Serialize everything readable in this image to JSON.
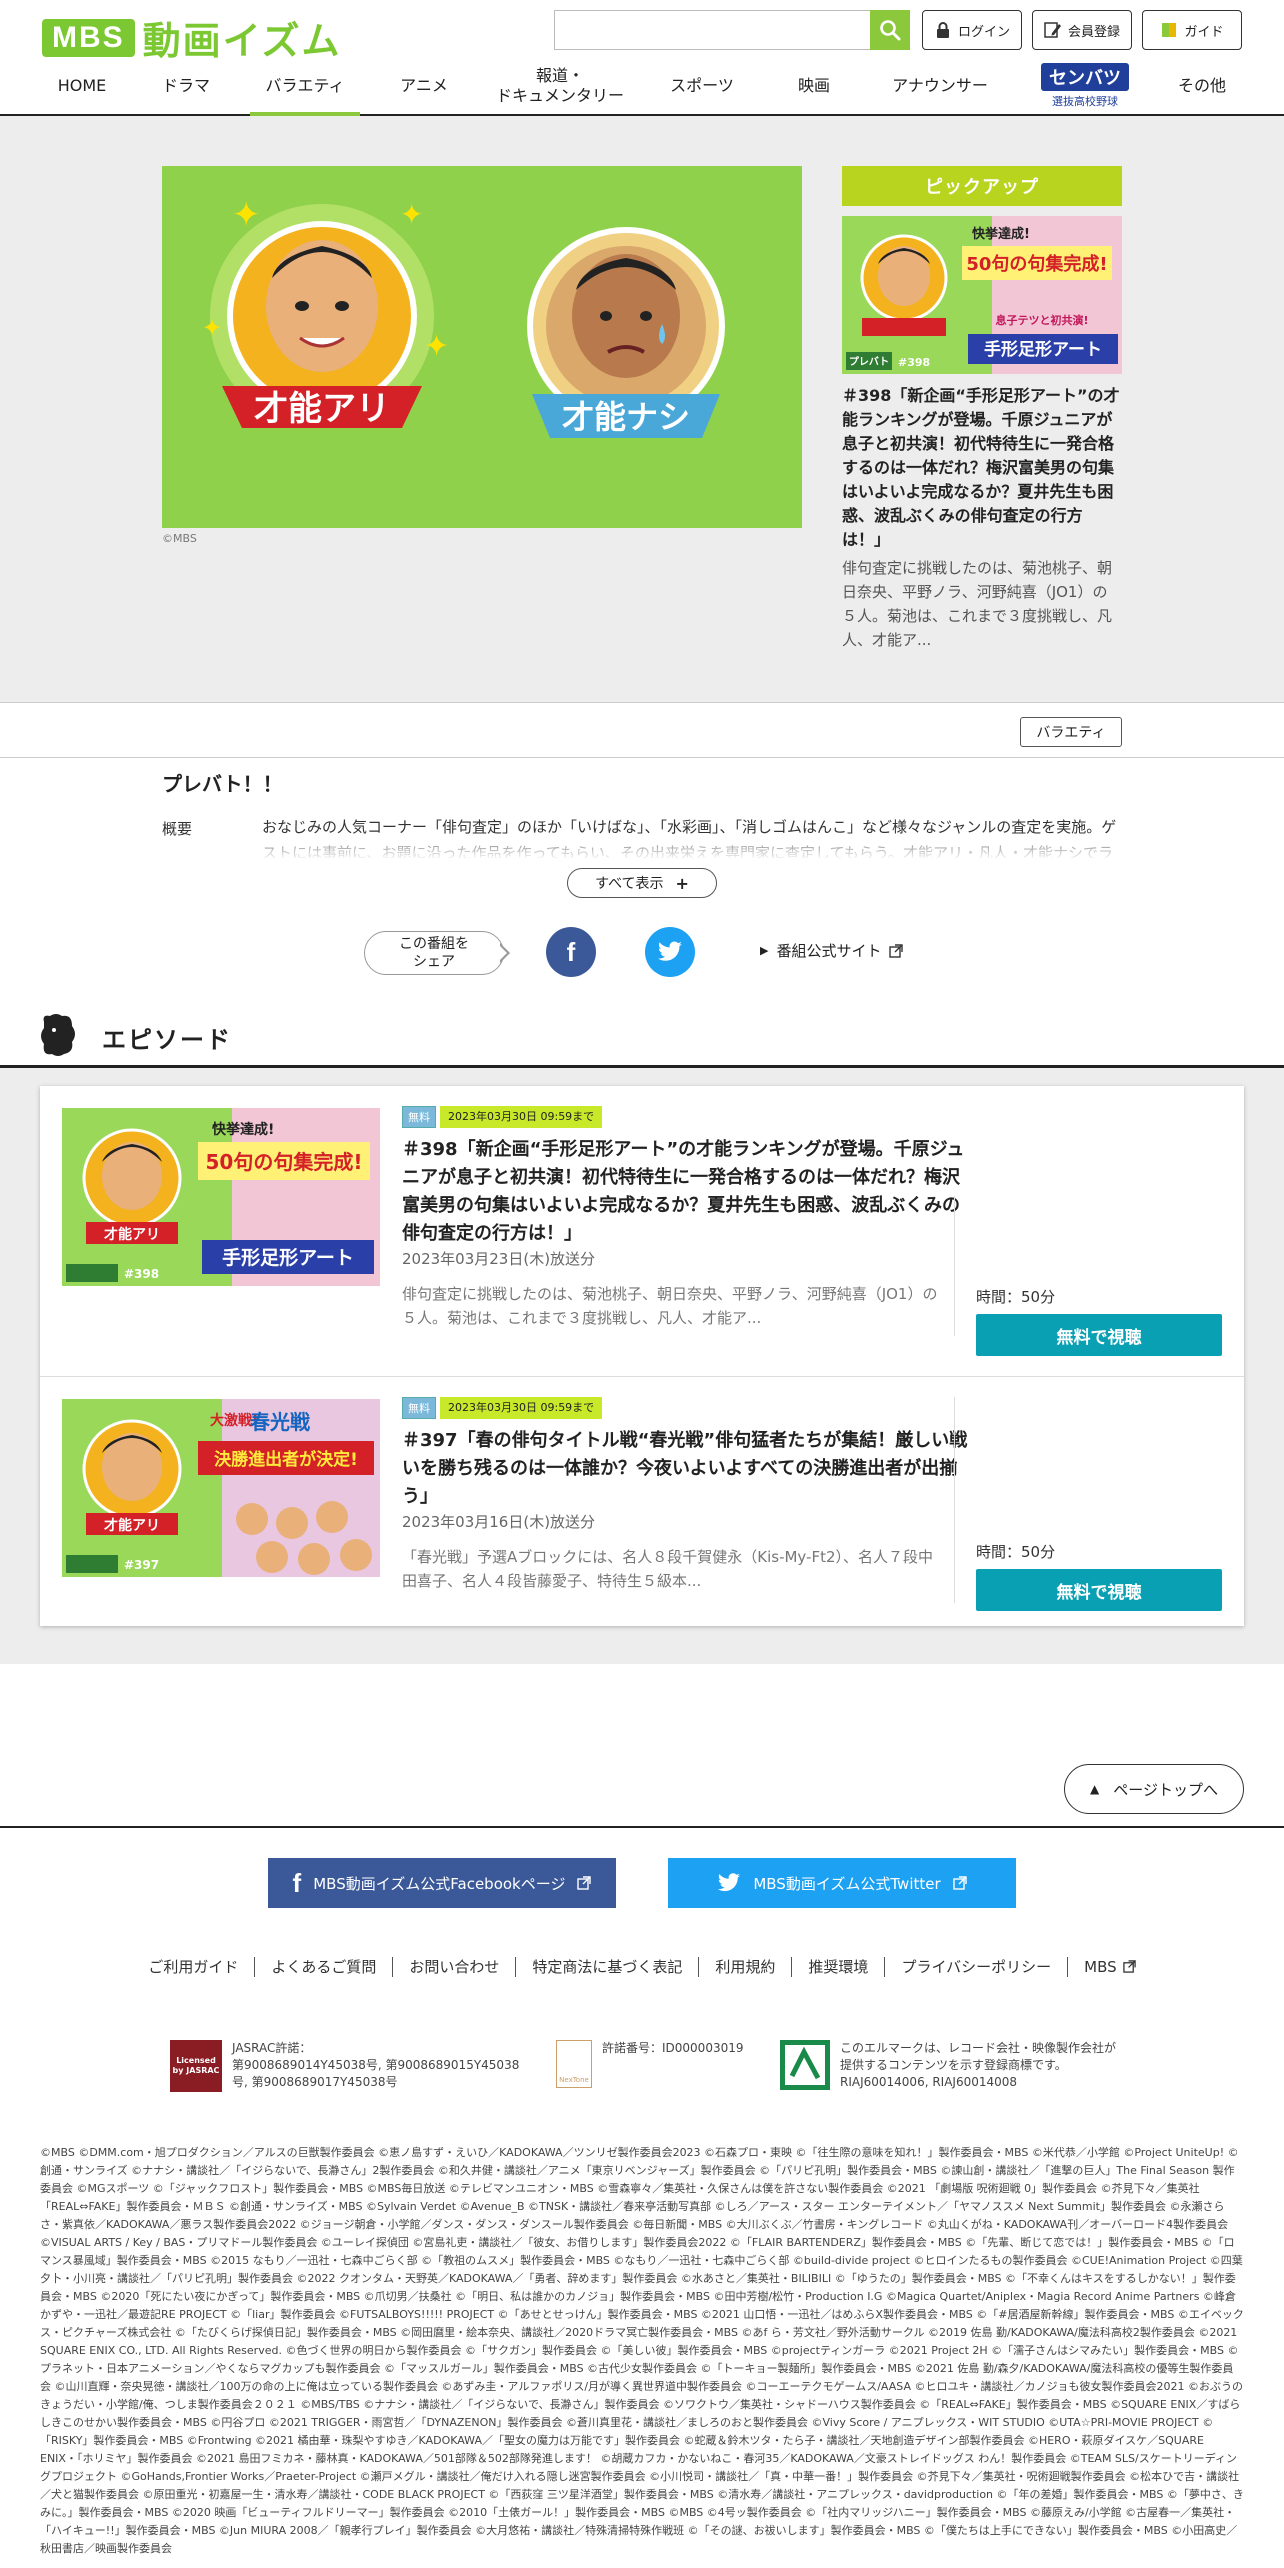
{
  "header": {
    "logo_mark": "MBS",
    "logo_text": "動画イズム",
    "search_placeholder": "",
    "login_label": "ログイン",
    "register_label": "会員登録",
    "guide_label": "ガイド"
  },
  "nav": {
    "items": [
      "HOME",
      "ドラマ",
      "バラエティ",
      "アニメ",
      "報道・",
      "ドキュメンタリー",
      "スポーツ",
      "映画",
      "アナウンサー",
      "その他"
    ],
    "senbatsu_logo": "センバツ",
    "senbatsu_sub": "選抜高校野球",
    "active": "バラエティ"
  },
  "hero": {
    "banner_left": "才能アリ",
    "banner_right": "才能ナシ",
    "copyright": "©MBS",
    "pickup_heading": "ピックアップ",
    "pickup_thumb_text1": "快挙達成!",
    "pickup_thumb_text2": "50句の句集完成!",
    "pickup_thumb_text3": "息子テツと初共演!",
    "pickup_thumb_text4": "手形足形アート",
    "pickup_thumb_brand": "プレバト",
    "pickup_thumb_num": "#398",
    "pickup_title": "＃398「新企画“手形足形アート”の才能ランキングが登場。千原ジュニアが息子と初共演！初代特待生に一発合格するのは一体だれ？梅沢富美男の句集はいよいよ完成なるか？夏井先生も困惑、波乱ぶくみの俳句査定の行方は！」",
    "pickup_desc": "俳句査定に挑戦したのは、菊池桃子、朝日奈央、平野ノラ、河野純喜（JO1）の５人。菊池は、これまで３度挑戦し、凡人、才能ア..."
  },
  "category": {
    "tag": "バラエティ"
  },
  "program": {
    "title": "プレバト！！",
    "overview_label": "概要",
    "overview_text": "おなじみの人気コーナー「俳句査定」のほか「いけばな」、「水彩画」、「消しゴムはんこ」など様々なジャンルの査定を実施。ゲストには事前に、お題に沿った作品を作ってもらい、その出来栄えを専門家に査定してもらう。才能アリ・凡人・才能ナシでランク付け。",
    "show_all": "すべて表示",
    "share_label": "この番組を\nシェア",
    "share_label_line1": "この番組を",
    "share_label_line2": "シェア",
    "official_site": "番組公式サイト"
  },
  "episodes_heading": "エピソード",
  "episodes": [
    {
      "badge_free": "無料",
      "badge_date": "2023年03月30日 09:59まで",
      "title": "＃398「新企画“手形足形アート”の才能ランキングが登場。千原ジュニアが息子と初共演！初代特待生に一発合格するのは一体だれ？梅沢富美男の句集はいよいよ完成なるか？夏井先生も困惑、波乱ぶくみの俳句査定の行方は！」",
      "aired": "2023年03月23日(木)放送分",
      "desc": "俳句査定に挑戦したのは、菊池桃子、朝日奈央、平野ノラ、河野純喜（JO1）の５人。菊池は、これまで３度挑戦し、凡人、才能ア...",
      "duration": "時間：50分",
      "watch": "無料で視聴",
      "thumb_text1": "快挙達成!",
      "thumb_text2": "50句の句集完成!",
      "thumb_text3": "手形足形アート",
      "thumb_text4": "才能アリ",
      "thumb_num": "#398"
    },
    {
      "badge_free": "無料",
      "badge_date": "2023年03月30日 09:59まで",
      "title": "＃397「春の俳句タイトル戦“春光戦”俳句猛者たちが集結！厳しい戦いを勝ち残るのは一体誰か？今夜いよいよすべての決勝進出者が出揃う」",
      "aired": "2023年03月16日(木)放送分",
      "desc": "「春光戦」予選Aブロックには、名人８段千賀健永（Kis-My-Ft2）、名人７段中田喜子、名人４段皆藤愛子、特待生５級本...",
      "duration": "時間：50分",
      "watch": "無料で視聴",
      "thumb_text1": "大激戦!",
      "thumb_text2": "春光戦",
      "thumb_text3": "決勝進出者が決定!",
      "thumb_text4": "才能アリ",
      "thumb_num": "#397"
    }
  ],
  "footer": {
    "page_top": "ページトップへ",
    "facebook": "MBS動画イズム公式Facebookページ",
    "twitter": "MBS動画イズム公式Twitter",
    "links": [
      "ご利用ガイド",
      "よくあるご質問",
      "お問い合わせ",
      "特定商法に基づく表記",
      "利用規約",
      "推奨環境",
      "プライバシーポリシー",
      "MBS"
    ],
    "jasrac_logo": "Licensed by JASRAC",
    "jasrac_title": "JASRAC許諾：",
    "jasrac_nums": "第9008689014Y45038号, 第9008689015Y45038号, 第9008689017Y45038号",
    "nextone_logo": "NexTone",
    "nextone_text": "許諾番号：ID000003019",
    "lmark_text": "このエルマークは、レコード会社・映像製作会社が提供するコンテンツを示す登録商標です。RIAJ60014006, RIAJ60014008",
    "credits": "©MBS ©DMM.com・旭プロダクション／アルスの巨獣製作委員会 ©恵ノ島すず・えいひ／KADOKAWA／ツンリゼ製作委員会2023 ©石森プロ・東映 ©「往生際の意味を知れ！」製作委員会・MBS ©米代恭／小学館 ©Project UniteUp! ©創通・サンライズ ©ナナシ・講談社／「イジらないで、長瀞さん」2製作委員会 ©和久井健・講談社／アニメ「東京リベンジャーズ」製作委員会 ©「パリピ孔明」製作委員会・MBS ©諫山創・講談社／「進撃の巨人」The Final Season 製作委員会 ©MGスポーツ ©「ジャックフロスト」製作委員会・MBS ©MBS毎日放送 ©テレビマンユニオン・MBS ©雪森寧々／集英社・久保さんは僕を許さない製作委員会 ©2021 「劇場版 呪術廻戦 0」製作委員会 ©芥見下々／集英社「REAL⇔FAKE」製作委員会・ＭＢＳ ©創通・サンライズ・MBS ©Sylvain Verdet ©Avenue_B ©TNSK・講談社／春来亭活動写真部 ©しろ／アース・スター エンターテイメント／「ヤマノススメ Next Summit」製作委員会 ©永瀬さらさ・紫真依／KADOKAWA／悪ラス製作委員会2022 ©ジョージ朝倉・小学館／ダンス・ダンス・ダンスール製作委員会 ©毎日新聞・MBS ©大川ぶくぶ／竹書房・キングレコード ©丸山くがね・KADOKAWA刊／オーバーロード4製作委員会 ©VISUAL ARTS / Key / BAS・プリマドール製作委員会 ©ユーレイ探偵団 ©宮島礼吏・講談社／「彼女、お借りします」製作委員会2022 ©「FLAIR BARTENDERZ」製作委員会・MBS ©「先輩、断じて恋では！」製作委員会・MBS ©「ロマンス暴風域」製作委員会・MBS ©2015 なもり／一迅社・七森中ごらく部 ©「教祖のムスメ」製作委員会・MBS ©なもり／一迅社・七森中ごらく部 ©build-divide project ©ヒロインたるもの製作委員会 ©CUE!Animation Project ©四葉夕卜・小川亮・講談社／「パリピ孔明」製作委員会 ©2022 クオンタム・天野英／KADOKAWA／「勇者、辞めます」製作委員会 ©水あさと／集英社・BILIBILI ©「ゆうたの」製作委員会・MBS ©「不幸くんはキスをするしかない！」製作委員会・MBS ©2020「死にたい夜にかぎって」製作委員会・MBS ©爪切男／扶桑社 ©「明日、私は誰かのカノジョ」製作委員会・MBS ©田中芳樹/松竹・Production I.G ©Magica Quartet/Aniplex・Magia Record Anime Partners ©峰倉かずや・一迅社／最遊記RE PROJECT ©「liar」製作委員会 ©FUTSALBOYS!!!!! PROJECT ©「あせとせっけん」製作委員会・MBS ©2021 山口悟・一迅社／はめふらX製作委員会・MBS ©「#居酒屋新幹線」製作委員会・MBS ©エイベックス・ピクチャーズ株式会社 ©「たびくらげ探偵日記」製作委員会・MBS ©岡田麿里・絵本奈央、講談社／2020ドラマ冥亡製作委員会・MBS ©あf ら・芳文社／野外活動サークル ©2019 佐島 勤/KADOKAWA/魔法科高校2製作委員会 ©2021 SQUARE ENIX CO., LTD. All Rights Reserved. ©色づく世界の明日から製作委員会 ©「サクガン」製作委員会 ©「美しい彼」製作委員会・MBS ©projectティンガーラ ©2021 Project 2H ©「濡子さんはシマみたい」製作委員会・MBS ©プラネット・日本アニメーション／やくならマグカップも製作委員会 ©「マッスルガール」製作委員会・MBS ©古代少女製作委員会 ©「トーキョー製麺所」製作委員会・MBS ©2021 佐島 勤/森夕/KADOKAWA/魔法科高校の優等生製作委員会 ©山川直輝・奈央晃徳・講談社／100万の命の上に俺は立っている製作委員会 ©あずみ圭・アルファポリス/月が導く異世界道中製作委員会 ©コーエーテクモゲームス/AASA ©ヒロユキ・講談社／カノジョも彼女製作委員会2021 ©おぶうのきょうだい・小学館/俺、つしま製作委員会２０２１ ©MBS/TBS ©ナナシ・講談社／「イジらないで、長瀞さん」製作委員会 ©ソワクトウ／集英社・シャドーハウス製作委員会 ©「REAL⇔FAKE」製作委員会・MBS ©SQUARE ENIX／すばらしきこのせかい製作委員会・MBS ©円谷プロ ©2021 TRIGGER・雨宮哲／「DYNAZENON」製作委員会 ©蒼川真里花・講談社／ましろのおと製作委員会 ©Vivy Score / アニプレックス・WIT STUDIO ©UTA☆PRI-MOVIE PROJECT ©「RISKY」製作委員会・MBS ©Frontwing ©2021 橘由華・珠梨やすゆき／KADOKAWA／「聖女の魔力は万能です」製作委員会 ©蛇蔵＆鈴木ツタ・たら子・講談社／天地創造デザイン部製作委員会 ©HERO・萩原ダイスケ／SQUARE ENIX・「ホリミヤ」製作委員会 ©2021 島田フミカネ・藤林真・KADOKAWA／501部隊＆502部隊発進します！ ©胡蔵カフカ・かないねこ・春河35／KADOKAWA／文豪ストレイドッグス わん！製作委員会 ©TEAM SLS/スケートリーディングプロジェクト ©GoHands,Frontier Works／Praeter-Project ©瀬戸メグル・講談社／俺だけ入れる隠し迷宮製作委員会 ©小川悦司・講談社／「真・中華一番！」製作委員会 ©芥見下々／集英社・呪術廻戦製作委員会 ©松本ひで吉・講談社／犬と猫製作委員会 ©原田重光・初嘉屋一生・清水寿／講談社・CODE BLACK PROJECT ©「西荻窪 三ツ星洋酒堂」製作委員会・MBS ©清水寿／講談社・アニプレックス・davidproduction ©「年の差婚」製作委員会・MBS ©「夢中さ、きみに。」製作委員会・MBS ©2020 映画「ビューティフルドリーマー」製作委員会 ©2010「土俵ガール！」製作委員会・MBS ©MBS ©4号ッ製作委員会 ©「社内マリッジハニー」製作委員会・MBS ©藤原えみ/小学館 ©古屋春一／集英社・「ハイキュー!!」製作委員会・MBS ©Jun MIURA 2008／「親孝行プレイ」製作委員会 ©大月悠祐・講談社／特殊清掃特殊作戦班 ©「その謎、お祓いします」製作委員会・MBS ©「僕たちは上手にできない」製作委員会・MBS ©小田高史／秋田書店／映画製作委員会"
  }
}
